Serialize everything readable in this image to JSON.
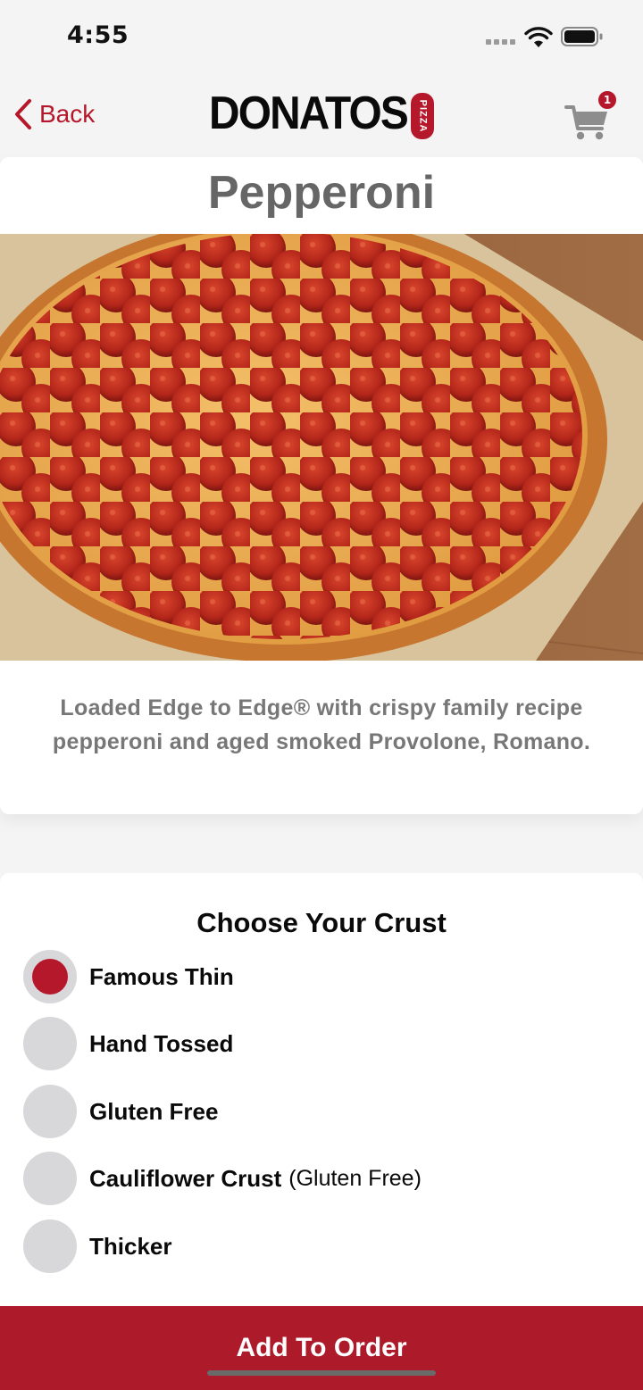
{
  "status_bar": {
    "time": "4:55"
  },
  "nav": {
    "back_label": "Back",
    "logo_text": "DONATOS",
    "logo_tag": "PIZZA",
    "cart_count": "1"
  },
  "product": {
    "title": "Pepperoni",
    "description": "Loaded Edge to Edge® with crispy family recipe pepperoni and aged smoked Provolone, Romano."
  },
  "crust": {
    "heading": "Choose Your Crust",
    "options": [
      {
        "label": "Famous Thin",
        "note": "",
        "selected": true
      },
      {
        "label": "Hand Tossed",
        "note": "",
        "selected": false
      },
      {
        "label": "Gluten Free",
        "note": "",
        "selected": false
      },
      {
        "label": "Cauliflower Crust",
        "note": "(Gluten Free)",
        "selected": false
      },
      {
        "label": "Thicker",
        "note": "",
        "selected": false
      }
    ]
  },
  "action": {
    "add_label": "Add To Order"
  },
  "colors": {
    "brand_red": "#b5182b",
    "button_red": "#ad1a29",
    "radio_gray": "#d8d8da"
  }
}
